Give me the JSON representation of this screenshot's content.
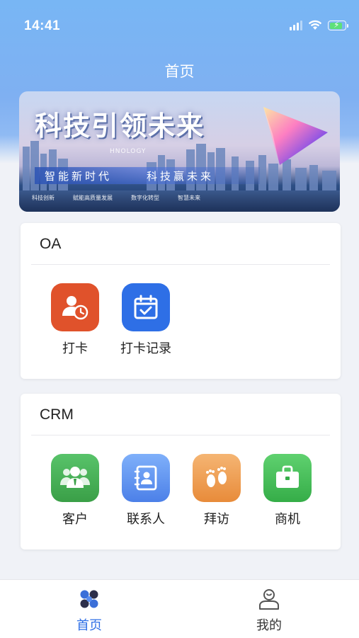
{
  "status_bar": {
    "time": "14:41"
  },
  "header": {
    "title": "首页"
  },
  "banner": {
    "headline": "科技引领未来",
    "english_text": "HNOLOGY",
    "slogan_left": "智能新时代",
    "slogan_right": "科技赢未来",
    "tags": [
      "科技创新",
      "赋能高质量发展",
      "数字化转型",
      "智慧未来"
    ]
  },
  "sections": [
    {
      "title": "OA",
      "apps": [
        {
          "label": "打卡",
          "icon": "user-clock-icon",
          "color": "#e0522b"
        },
        {
          "label": "打卡记录",
          "icon": "calendar-check-icon",
          "color": "#2e6fe6"
        }
      ]
    },
    {
      "title": "CRM",
      "apps": [
        {
          "label": "客户",
          "icon": "customers-icon",
          "color": "#3fae4e"
        },
        {
          "label": "联系人",
          "icon": "contact-book-icon",
          "color": "#5c8ff0"
        },
        {
          "label": "拜访",
          "icon": "footprints-icon",
          "color": "#ef9b4f"
        },
        {
          "label": "商机",
          "icon": "briefcase-icon",
          "color": "#3fba52"
        }
      ]
    }
  ],
  "tabbar": {
    "items": [
      {
        "label": "首页",
        "icon": "home-grid-icon",
        "active": true,
        "color": "#2f6fe6"
      },
      {
        "label": "我的",
        "icon": "user-profile-icon",
        "active": false,
        "color": "#333333"
      }
    ]
  }
}
